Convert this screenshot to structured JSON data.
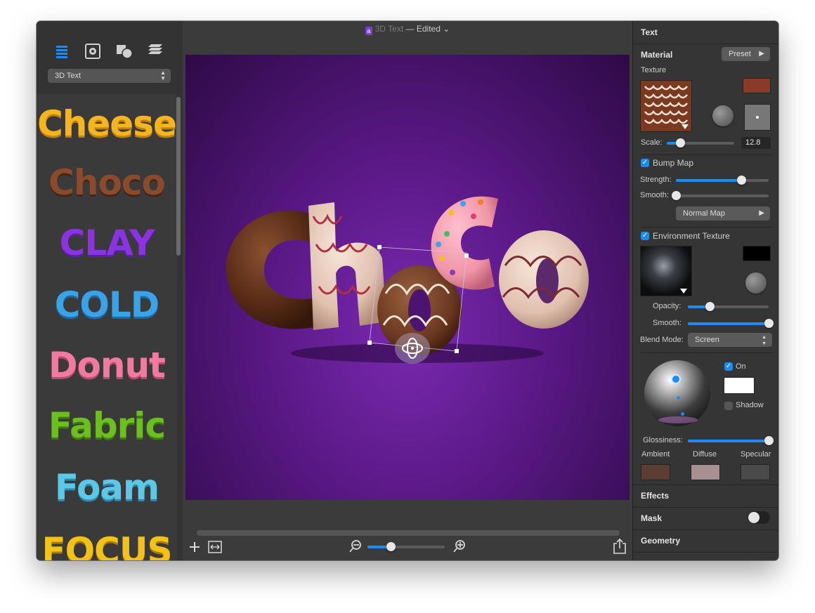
{
  "window": {
    "title_app": "a",
    "title_doc": "3D Text",
    "title_state": "— Edited",
    "title_chevron": "⌄"
  },
  "sidebar": {
    "style_select": "3D Text",
    "presets": [
      {
        "label": "Cheese",
        "color": "#f5b51e"
      },
      {
        "label": "Choco",
        "color": "#7a3d22"
      },
      {
        "label": "CLAY",
        "color": "#8a34e0"
      },
      {
        "label": "COLD",
        "color": "#3aa3e8"
      },
      {
        "label": "Donut",
        "color": "#f07aa0"
      },
      {
        "label": "Fabric",
        "color": "#6cc01e"
      },
      {
        "label": "Foam",
        "color": "#5cc8e6"
      },
      {
        "label": "FOCUS",
        "color": "#f2c21b"
      }
    ]
  },
  "canvas": {
    "text": "Choco",
    "background": "#5d1a8a"
  },
  "inspector": {
    "text_title": "Text",
    "material_title": "Material",
    "preset_button": "Preset",
    "texture_label": "Texture",
    "texture_color": "#8a3a28",
    "scale_label": "Scale:",
    "scale_value": "12.8",
    "scale_level": 0.2,
    "bump_map_label": "Bump Map",
    "strength_label": "Strength:",
    "strength_level": 0.71,
    "bump_smooth_label": "Smooth:",
    "bump_smooth_level": 0.0,
    "normal_map_button": "Normal Map",
    "env_texture_label": "Environment Texture",
    "env_color": "#000000",
    "opacity_label": "Opacity:",
    "opacity_level": 0.27,
    "env_smooth_label": "Smooth:",
    "env_smooth_level": 1.0,
    "blend_mode_label": "Blend Mode:",
    "blend_mode_value": "Screen",
    "light_on_label": "On",
    "light_color": "#ffffff",
    "shadow_label": "Shadow",
    "glossiness_label": "Glossiness:",
    "glossiness_level": 1.0,
    "ambient_label": "Ambient",
    "diffuse_label": "Diffuse",
    "specular_label": "Specular",
    "ambient_color": "#5a3d33",
    "diffuse_color": "#a89090",
    "specular_color": "#4a4a4a",
    "effects_title": "Effects",
    "mask_title": "Mask",
    "geometry_title": "Geometry"
  },
  "bottom": {
    "zoom_level": 0.3
  }
}
